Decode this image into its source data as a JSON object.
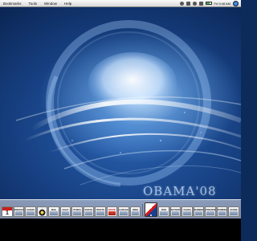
{
  "menubar": {
    "menus": [
      "Bookmarks",
      "Tools",
      "Window",
      "Help"
    ],
    "clock": "Fri 9:48 AM"
  },
  "watermark": "OBAMA'08",
  "dock": {
    "items": [
      {
        "name": "calendar",
        "label": "1"
      },
      {
        "name": "app-1",
        "label": "FIREFOX"
      },
      {
        "name": "app-2",
        "label": "SAFARI"
      },
      {
        "name": "penguin",
        "label": ""
      },
      {
        "name": "app-4",
        "label": "MAIL"
      },
      {
        "name": "app-5",
        "label": "ICHAT"
      },
      {
        "name": "app-6",
        "label": "ITUNES"
      },
      {
        "name": "app-7",
        "label": "PHOTO"
      },
      {
        "name": "app-8",
        "label": "IPHOTO"
      },
      {
        "name": "app-9",
        "label": "IMOVIE"
      },
      {
        "name": "app-10",
        "label": "GARAGE"
      },
      {
        "name": "app-11",
        "label": "IWEB"
      },
      {
        "name": "active-app",
        "label": ""
      },
      {
        "name": "app-13",
        "label": "IDVD"
      },
      {
        "name": "app-14",
        "label": "KEYNOTE"
      },
      {
        "name": "app-15",
        "label": "PAGES"
      },
      {
        "name": "app-16",
        "label": "NUMBERS"
      },
      {
        "name": "app-17",
        "label": "PREVIEW"
      },
      {
        "name": "app-18",
        "label": "TERMINAL"
      },
      {
        "name": "app-19",
        "label": "XCODE"
      }
    ]
  }
}
